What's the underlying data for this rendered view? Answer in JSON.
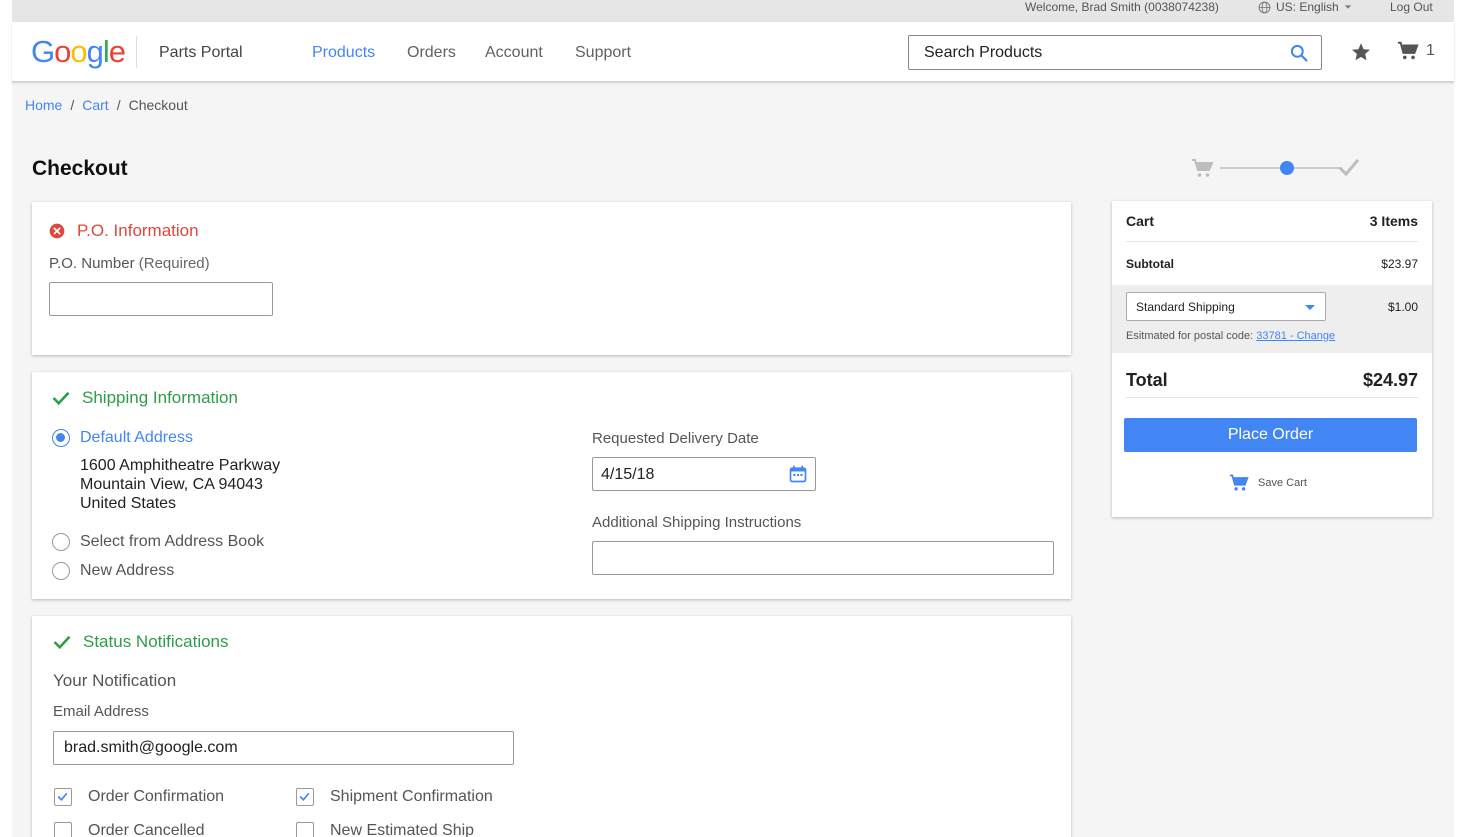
{
  "topbar": {
    "welcome": "Welcome, Brad Smith (0038074238)",
    "language": "US: English",
    "logout": "Log Out"
  },
  "header": {
    "logo_letters": [
      "G",
      "o",
      "o",
      "g",
      "l",
      "e"
    ],
    "logo_colors": [
      "#4285f4",
      "#ea4335",
      "#fbbc05",
      "#4285f4",
      "#34a853",
      "#ea4335"
    ],
    "portal_name": "Parts Portal",
    "nav": [
      "Products",
      "Orders",
      "Account",
      "Support"
    ],
    "active_nav": "Products",
    "search_placeholder": "Search Products",
    "cart_count": "1"
  },
  "breadcrumb": {
    "home": "Home",
    "cart": "Cart",
    "current": "Checkout",
    "separator": "/"
  },
  "page_title": "Checkout",
  "po_section": {
    "title": "P.O. Information",
    "label": "P.O. Number",
    "label_note": "(Required)",
    "value": "",
    "status_icon": "error-circle-icon"
  },
  "shipping_section": {
    "title": "Shipping Information",
    "options": {
      "default": "Default Address",
      "address_book": "Select from Address Book",
      "new": "New Address"
    },
    "address_lines": [
      "1600 Amphitheatre Parkway",
      "Mountain View, CA 94043",
      "United States"
    ],
    "delivery_date_label": "Requested Delivery Date",
    "delivery_date_value": "4/15/18",
    "instructions_label": "Additional Shipping Instructions",
    "instructions_value": ""
  },
  "notifications_section": {
    "title": "Status Notifications",
    "subtitle": "Your Notification",
    "email_label": "Email Address",
    "email_value": "brad.smith@google.com",
    "checks": {
      "order_confirmation": "Order Confirmation",
      "shipment_confirmation": "Shipment Confirmation",
      "order_cancelled": "Order Cancelled",
      "new_estimated_ship": "New Estimated Ship"
    }
  },
  "summary": {
    "cart_label": "Cart",
    "items_count": "3 Items",
    "subtotal_label": "Subtotal",
    "subtotal_value": "$23.97",
    "shipping_option": "Standard Shipping",
    "shipping_cost": "$1.00",
    "postal_note": "Esitmated for postal code:",
    "postal_link": "33781 - Change",
    "total_label": "Total",
    "total_value": "$24.97",
    "place_order": "Place Order",
    "save_cart": "Save Cart"
  },
  "colors": {
    "accent": "#4285f4",
    "error": "#e0463a",
    "success": "#2e9d48"
  }
}
